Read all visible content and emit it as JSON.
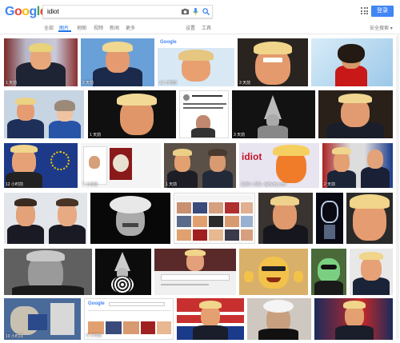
{
  "search": {
    "query": "idiot"
  },
  "header": {
    "logo_letters": [
      {
        "ch": "G",
        "color": "#4285f4"
      },
      {
        "ch": "o",
        "color": "#ea4335"
      },
      {
        "ch": "o",
        "color": "#fbbc05"
      },
      {
        "ch": "g",
        "color": "#4285f4"
      },
      {
        "ch": "l",
        "color": "#34a853"
      },
      {
        "ch": "e",
        "color": "#ea4335"
      }
    ],
    "login_label": "登录",
    "icons": [
      "camera-icon",
      "mic-icon",
      "search-icon",
      "apps-grid-icon"
    ]
  },
  "tabs": {
    "all": "全部",
    "images": "图片",
    "maps": "地图",
    "videos": "视频",
    "news": "新闻",
    "more": "更多",
    "settings": "设置",
    "tools": "工具",
    "safesearch": "安全搜索"
  },
  "accent_color": "#1a73e8",
  "captions": {
    "r1_1": "1 天前",
    "r1_2": "2 天前",
    "r1_3": "13 小时前",
    "r1_4": "3 天前",
    "r2_5": "1 天前",
    "r2_6": "3 天前",
    "r3_1": "12 小时前",
    "r3_2": "7 小时前",
    "r3_3": "1 天前",
    "r3_4": "1200 × 650 - fatherly.com",
    "r3_5": "2 天前",
    "r6_1": "10 小时前",
    "r6_2": "9 小时前"
  },
  "embedded_text": {
    "idiot_word": "idiot",
    "google_mini": "Google"
  }
}
